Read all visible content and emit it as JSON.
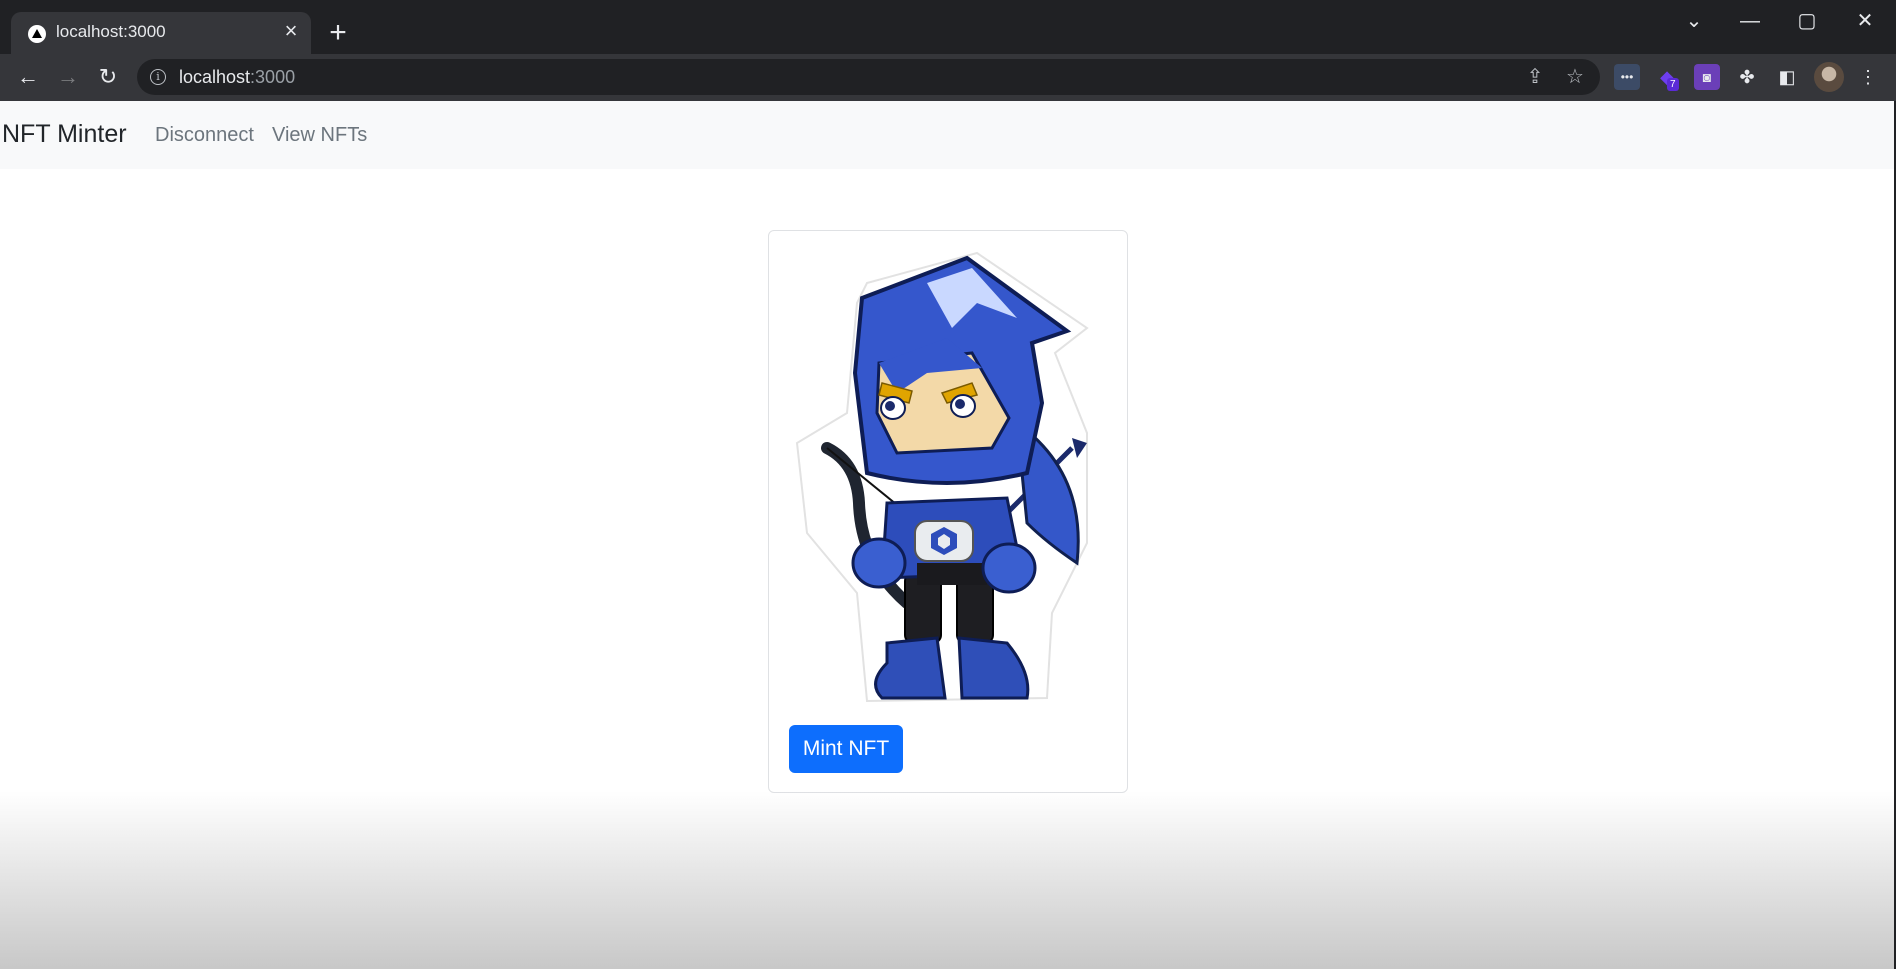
{
  "browser": {
    "tab": {
      "title": "localhost:3000",
      "favicon": "nextjs-icon"
    },
    "address": {
      "host": "localhost",
      "port": ":3000"
    },
    "extensions": [
      {
        "icon": "dots-extension-icon"
      },
      {
        "icon": "purple-extension-icon",
        "badge": "7"
      },
      {
        "icon": "wallet-extension-icon"
      },
      {
        "icon": "puzzle-icon"
      }
    ]
  },
  "navbar": {
    "brand": "NFT Minter",
    "links": [
      "Disconnect",
      "View NFTs"
    ]
  },
  "card": {
    "image": "hooded-archer-character",
    "button_label": "Mint NFT"
  },
  "colors": {
    "primary": "#0d6efd",
    "navbar_bg": "#f8f9fa",
    "chrome_dark": "#202124",
    "chrome_toolbar": "#35363a"
  }
}
